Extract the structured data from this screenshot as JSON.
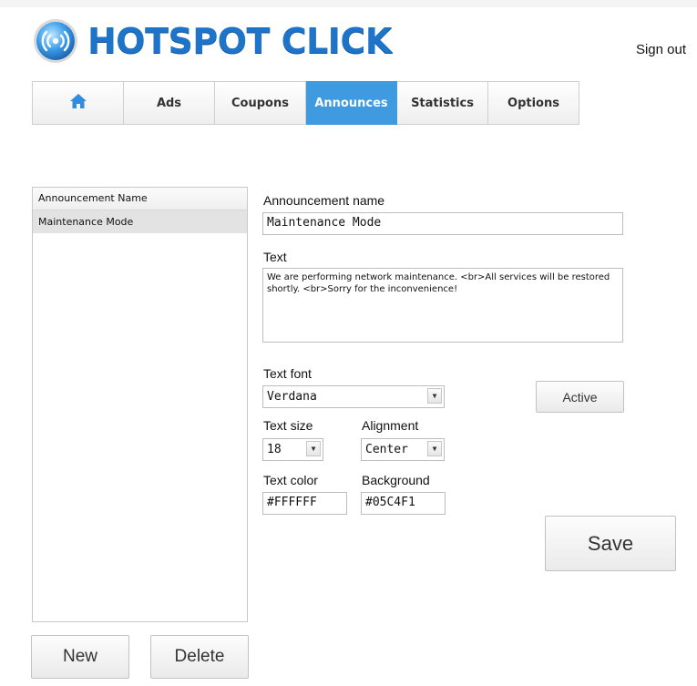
{
  "app": {
    "logo_text": "HOTSPOT CLICK",
    "logo_icon": "wifi-signal-icon",
    "signout": "Sign out",
    "accent": "#3f9ae0",
    "logo_color": "#1d74c9"
  },
  "tabs": [
    {
      "label": "",
      "icon": "home-icon",
      "active": false
    },
    {
      "label": "Ads",
      "active": false
    },
    {
      "label": "Coupons",
      "active": false
    },
    {
      "label": "Announces",
      "active": true
    },
    {
      "label": "Statistics",
      "active": false
    },
    {
      "label": "Options",
      "active": false
    }
  ],
  "list": {
    "header": "Announcement Name",
    "rows": [
      "Maintenance Mode"
    ]
  },
  "buttons": {
    "new": "New",
    "delete": "Delete",
    "active": "Active",
    "save": "Save"
  },
  "form": {
    "name_label": "Announcement name",
    "name_value": "Maintenance Mode",
    "text_label": "Text",
    "text_value": "We are performing network maintenance. <br>All services will be restored shortly. <br>Sorry for the inconvenience!",
    "font_label": "Text font",
    "font_value": "Verdana",
    "size_label": "Text size",
    "size_value": "18",
    "align_label": "Alignment",
    "align_value": "Center",
    "color_label": "Text color",
    "color_value": "#FFFFFF",
    "bg_label": "Background",
    "bg_value": "#05C4F1"
  }
}
